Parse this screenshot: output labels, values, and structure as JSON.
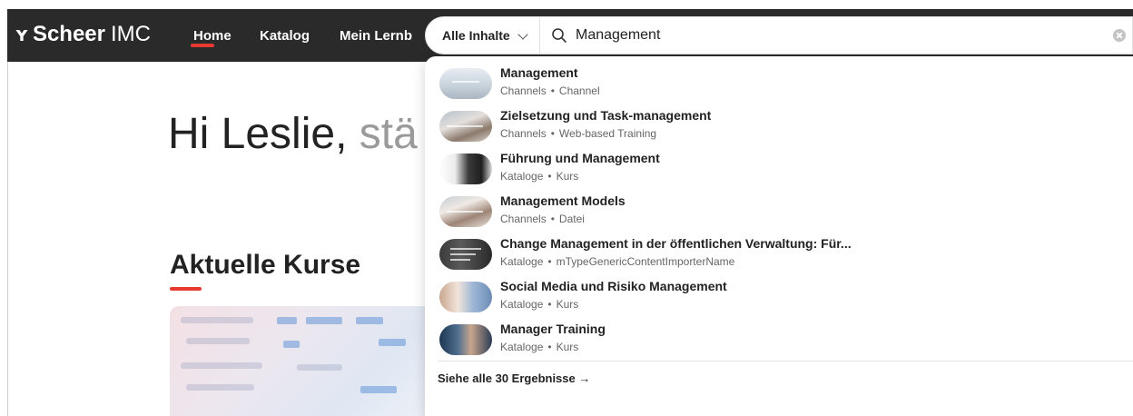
{
  "header": {
    "logo_mark": "ʏ",
    "logo_strong": "Scheer",
    "logo_light": "IMC",
    "nav": [
      {
        "label": "Home",
        "active": true
      },
      {
        "label": "Katalog"
      },
      {
        "label": "Mein Lernb"
      }
    ],
    "accent_color": "#e63a30"
  },
  "main": {
    "greeting_name": "Hi Leslie,",
    "greeting_rest": " stä",
    "section_title": "Aktuelle Kurse"
  },
  "search": {
    "scope_label": "Alle Inhalte",
    "query": "Management",
    "search_icon": "search-icon",
    "clear_icon": "clear-icon"
  },
  "results": [
    {
      "title": "Management",
      "category": "Channels",
      "type": "Channel"
    },
    {
      "title": "Zielsetzung und Task-management",
      "category": "Channels",
      "type": "Web-based Training"
    },
    {
      "title": "Führung und Management",
      "category": "Kataloge",
      "type": "Kurs"
    },
    {
      "title": "Management Models",
      "category": "Channels",
      "type": "Datei"
    },
    {
      "title": "Change Management in der öffentlichen Verwaltung: Für...",
      "category": "Kataloge",
      "type": "mTypeGenericContentImporterName"
    },
    {
      "title": "Social Media und Risiko Management",
      "category": "Kataloge",
      "type": "Kurs"
    },
    {
      "title": "Manager Training",
      "category": "Kataloge",
      "type": "Kurs"
    }
  ],
  "see_all": "Siehe alle 30 Ergebnisse →",
  "meta_separator": "•"
}
